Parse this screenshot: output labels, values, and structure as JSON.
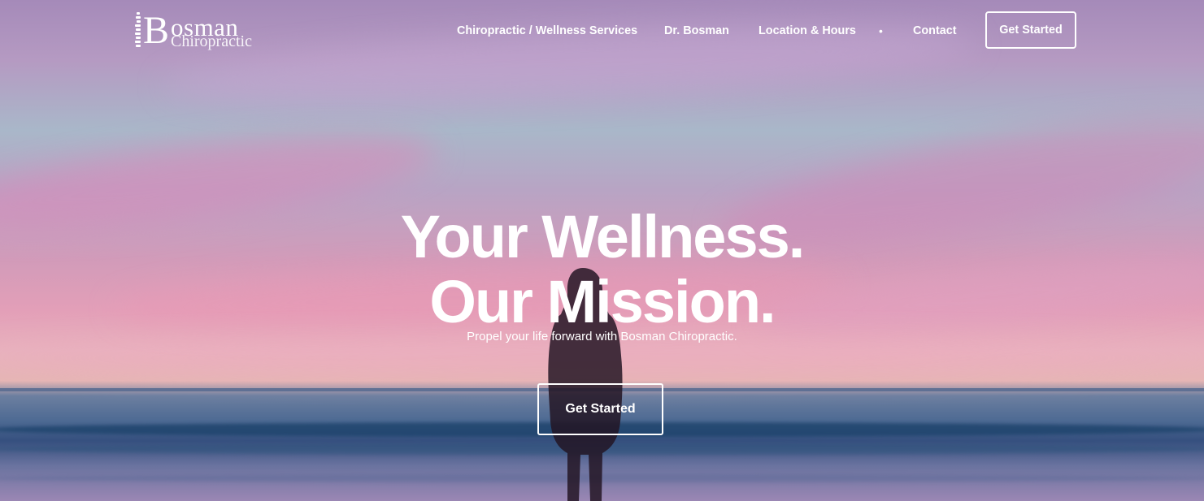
{
  "brand": {
    "name": "Bosman",
    "subtitle": "Chiropractic"
  },
  "nav": {
    "items": [
      {
        "label": "Chiropractic / Wellness Services"
      },
      {
        "label": "Dr. Bosman"
      },
      {
        "label": "Location & Hours"
      },
      {
        "label": "Contact"
      }
    ],
    "separator": "•",
    "cta": "Get Started"
  },
  "hero": {
    "title_line1": "Your Wellness.",
    "title_line2": "Our Mission.",
    "tagline": "Propel your life forward with Bosman Chiropractic.",
    "cta": "Get Started"
  },
  "colors": {
    "text": "#ffffff",
    "sky_purple": "#a58ab9",
    "sunset_pink": "#e39fb8",
    "ocean_blue": "#36507f"
  }
}
